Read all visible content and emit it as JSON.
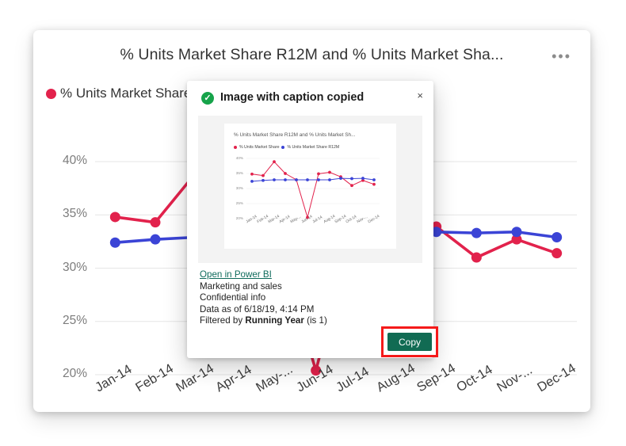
{
  "card": {
    "title": "% Units Market Share R12M and % Units Market Sha...",
    "menu_label": "•••",
    "menu_icon": "ellipsis-icon"
  },
  "legend": {
    "series1": {
      "label": "% Units Market Share",
      "color": "#e2224c"
    },
    "series2": {
      "label": "% Units Market Share R12M",
      "color": "#3b44d6"
    }
  },
  "dialog": {
    "title": "Image with caption copied",
    "success_icon": "check-circle-icon",
    "check_glyph": "✓",
    "close_icon": "close-icon",
    "close_glyph": "×",
    "link": "Open in Power BI",
    "line_workspace": "Marketing and sales",
    "line_sensitivity": "Confidential info",
    "line_data_as_of": "Data as of 6/18/19, 4:14 PM",
    "filter_prefix": "Filtered by ",
    "filter_name": "Running Year",
    "filter_value": " (is 1)",
    "copy_label": "Copy",
    "copy_color": "#116b53",
    "highlight_color": "#f51a1a"
  },
  "thumbnail": {
    "title": "% Units Market Share R12M and % Units Market Sh..."
  },
  "chart_data": {
    "type": "line",
    "title": "% Units Market Share R12M and % Units Market Sha...",
    "xlabel": "",
    "ylabel": "",
    "ylim": [
      20,
      40
    ],
    "yticks": [
      "40%",
      "35%",
      "30%",
      "25%",
      "20%"
    ],
    "ytick_values": [
      40,
      35,
      30,
      25,
      20
    ],
    "grid": true,
    "legend_position": "top-left",
    "categories": [
      "Jan-14",
      "Feb-14",
      "Mar-14",
      "Apr-14",
      "May-...",
      "Jun-14",
      "Jul-14",
      "Aug-14",
      "Sep-14",
      "Oct-14",
      "Nov-...",
      "Dec-14"
    ],
    "series": [
      {
        "name": "% Units Market Share",
        "color": "#e2224c",
        "values": [
          34.8,
          34.3,
          38.9,
          35.0,
          32.9,
          20.4,
          34.9,
          35.4,
          33.9,
          31.0,
          32.7,
          31.4
        ]
      },
      {
        "name": "% Units Market Share R12M",
        "color": "#3b44d6",
        "values": [
          32.4,
          32.7,
          32.9,
          32.9,
          32.9,
          32.9,
          32.9,
          32.9,
          33.4,
          33.3,
          33.4,
          32.9
        ]
      }
    ]
  }
}
